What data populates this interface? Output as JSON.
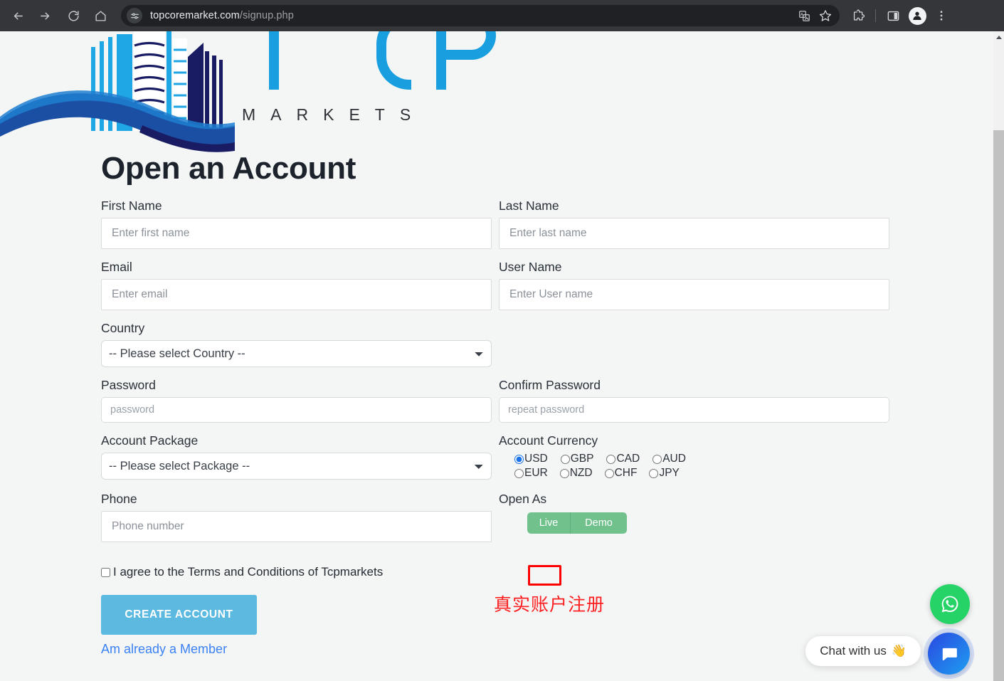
{
  "browser": {
    "back_icon": "arrow-left-icon",
    "forward_icon": "arrow-right-icon",
    "reload_icon": "reload-icon",
    "home_icon": "home-icon",
    "site_info_icon": "page-settings-icon",
    "url_domain": "topcoremarket.com",
    "url_path": "/signup.php",
    "translate_icon": "translate-icon",
    "bookmark_icon": "star-icon",
    "extensions_icon": "puzzle-icon",
    "side_panel_icon": "split-panel-icon",
    "profile_icon": "person-avatar-icon",
    "menu_icon": "three-dot-menu-icon"
  },
  "logo": {
    "wordmark": "TCP",
    "tagline": "M A R K E T S",
    "primary_color": "#199fe0",
    "dark_color": "#1b1b63"
  },
  "page": {
    "title": "Open an Account",
    "background_color": "#f4f5f5"
  },
  "form": {
    "first_name": {
      "label": "First Name",
      "placeholder": "Enter first name",
      "value": ""
    },
    "last_name": {
      "label": "Last Name",
      "placeholder": "Enter last name",
      "value": ""
    },
    "email": {
      "label": "Email",
      "placeholder": "Enter email",
      "value": ""
    },
    "user_name": {
      "label": "User Name",
      "placeholder": "Enter User name",
      "value": ""
    },
    "country": {
      "label": "Country",
      "selected": "-- Please select Country --"
    },
    "password": {
      "label": "Password",
      "placeholder": "password",
      "value": ""
    },
    "confirm_password": {
      "label": "Confirm Password",
      "placeholder": "repeat password",
      "value": ""
    },
    "account_package": {
      "label": "Account Package",
      "selected": "-- Please select Package --"
    },
    "account_currency": {
      "label": "Account Currency",
      "selected": "USD",
      "row1": [
        "USD",
        "GBP",
        "CAD",
        "AUD"
      ],
      "row2": [
        "EUR",
        "NZD",
        "CHF",
        "JPY"
      ]
    },
    "phone": {
      "label": "Phone",
      "placeholder": "Phone number",
      "value": ""
    },
    "open_as": {
      "label": "Open As",
      "live_label": "Live",
      "demo_label": "Demo",
      "button_color": "#70c18c"
    },
    "terms": {
      "label": "I agree to the Terms and Conditions of Tcpmarkets",
      "checked": false
    },
    "submit_label": "CREATE ACCOUNT",
    "submit_color": "#5cb9e0",
    "member_link": "Am already a Member",
    "member_link_color": "#3b82f4"
  },
  "annotation": {
    "highlight_target": "Live",
    "highlight_color": "#fe0000",
    "text": "真实账户注册"
  },
  "widgets": {
    "whatsapp": {
      "icon": "whatsapp-icon",
      "color": "#25d366"
    },
    "livechat": {
      "icon": "chat-bubble-icon",
      "color": "#2851e3"
    },
    "chat_tooltip": {
      "text": "Chat with us",
      "emoji": "👋"
    }
  }
}
